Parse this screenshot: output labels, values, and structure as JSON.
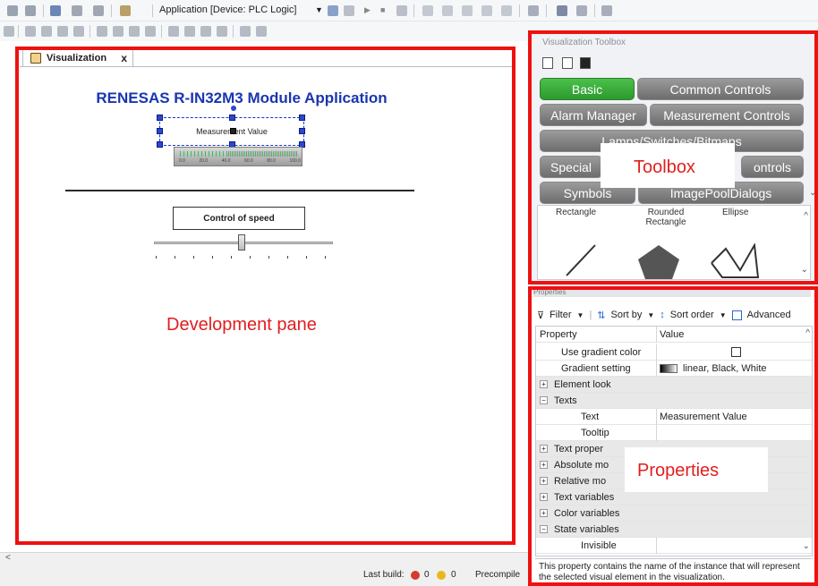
{
  "toolbar": {
    "application_label": "Application [Device: PLC Logic]"
  },
  "dev_pane": {
    "tab_label": "Visualization",
    "tab_close": "x",
    "visual": {
      "title": "RENESAS R-IN32M3 Module Application",
      "measure_text": "Measurement Value",
      "meter_scale": [
        "0.0",
        "20.0",
        "40.0",
        "60.0",
        "80.0",
        "100.0"
      ],
      "speed_label": "Control of speed"
    },
    "annotation": "Development pane"
  },
  "statusbar": {
    "last_build_label": "Last build:",
    "errors": "0",
    "warnings": "0",
    "precompile": "Precompile"
  },
  "toolbox": {
    "title": "Visualization Toolbox",
    "annotation": "Toolbox",
    "categories": [
      {
        "label": "Basic"
      },
      {
        "label": "Common Controls"
      },
      {
        "label": "Alarm Manager"
      },
      {
        "label": "Measurement Controls"
      },
      {
        "label": "Lamps/Switches/Bitmaps"
      },
      {
        "label": "Special"
      },
      {
        "label": "ontrols"
      },
      {
        "label": "Symbols"
      },
      {
        "label": "ImagePoolDialogs"
      }
    ],
    "shapes": [
      "Rectangle",
      "Rounded Rectangle",
      "Ellipse"
    ],
    "colors": {
      "active": "#3aad3a",
      "inactive": "#858585"
    }
  },
  "properties": {
    "header": "Properties",
    "annotation": "Properties",
    "toolbar": {
      "filter": "Filter",
      "sort_by": "Sort by",
      "sort_order": "Sort order",
      "advanced": "Advanced"
    },
    "columns": [
      "Property",
      "Value"
    ],
    "rows": [
      {
        "name": "Use gradient color",
        "value": ""
      },
      {
        "name": "Gradient setting",
        "value": "linear, Black, White"
      },
      {
        "name": "Element look",
        "value": ""
      },
      {
        "name": "Texts",
        "value": ""
      },
      {
        "name": "Text",
        "value": "Measurement Value"
      },
      {
        "name": "Tooltip",
        "value": ""
      },
      {
        "name": "Text proper",
        "value": ""
      },
      {
        "name": "Absolute mo",
        "value": ""
      },
      {
        "name": "Relative mo",
        "value": ""
      },
      {
        "name": "Text variables",
        "value": ""
      },
      {
        "name": "Color variables",
        "value": ""
      },
      {
        "name": "State variables",
        "value": ""
      },
      {
        "name": "Invisible",
        "value": ""
      }
    ],
    "description": "This property contains the name of the instance that will represent the selected visual element in the visualization."
  }
}
